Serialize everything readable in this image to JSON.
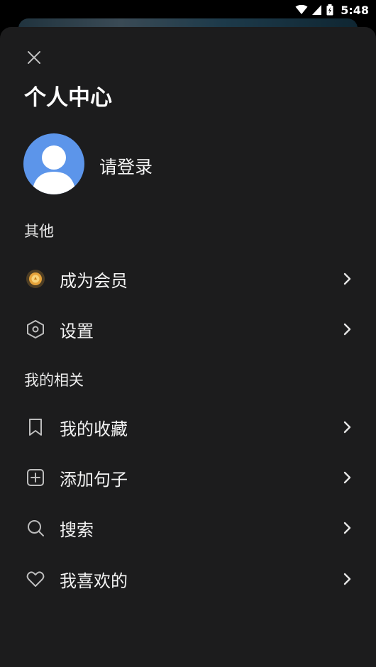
{
  "status": {
    "time": "5:48"
  },
  "header": {
    "title": "个人中心"
  },
  "profile": {
    "login_label": "请登录"
  },
  "sections": {
    "other": {
      "title": "其他",
      "items": [
        {
          "label": "成为会员",
          "icon": "vip-coin-icon"
        },
        {
          "label": "设置",
          "icon": "settings-hexagon-icon"
        }
      ]
    },
    "mine": {
      "title": "我的相关",
      "items": [
        {
          "label": "我的收藏",
          "icon": "bookmark-icon"
        },
        {
          "label": "添加句子",
          "icon": "add-square-icon"
        },
        {
          "label": "搜索",
          "icon": "search-icon"
        },
        {
          "label": "我喜欢的",
          "icon": "heart-icon"
        }
      ]
    }
  },
  "colors": {
    "sheet_bg": "#1c1c1d",
    "avatar_bg": "#5c95ea",
    "vip_gold": "#e5a23a",
    "text": "#f4f4f4",
    "icon_gray": "#bdbdbd"
  }
}
